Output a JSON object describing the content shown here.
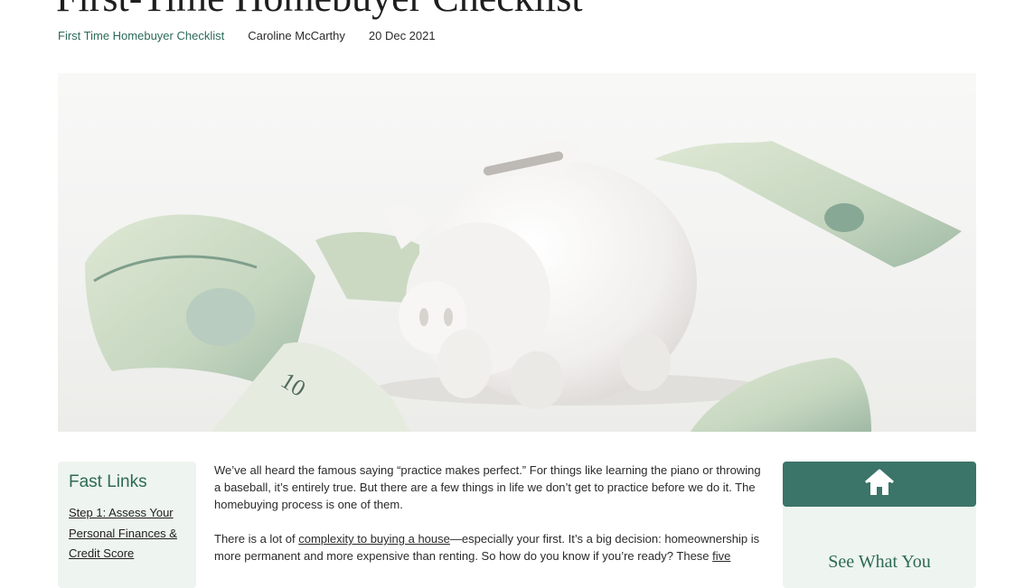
{
  "article": {
    "title": "First-Time Homebuyer Checklist",
    "category": "First Time Homebuyer Checklist",
    "author": "Caroline McCarthy",
    "date": "20 Dec 2021",
    "hero_image": "piggy-bank-with-dollar-bills",
    "paragraphs": [
      {
        "text": "We’ve all heard the famous saying “practice makes perfect.” For things like learning the piano or throwing a baseball, it’s entirely true. But there are a few things in life we don’t get to practice before we do it. The homebuying process is one of them."
      },
      {
        "before": "There is a lot of ",
        "link": "complexity to buying a house",
        "middle": "—especially your first. It’s a big decision: homeownership is more permanent and more expensive than renting. So how do you know if you’re ready? These ",
        "link2": "five"
      }
    ]
  },
  "sidebar": {
    "fast_links_title": "Fast Links",
    "links": [
      "Step 1: Assess Your Personal Finances & Credit Score"
    ]
  },
  "cta": {
    "icon": "house-icon",
    "title": "See What You"
  },
  "colors": {
    "brand_green": "#2d6a58",
    "cta_header": "#3b7468",
    "panel_bg": "#eef4ef"
  }
}
